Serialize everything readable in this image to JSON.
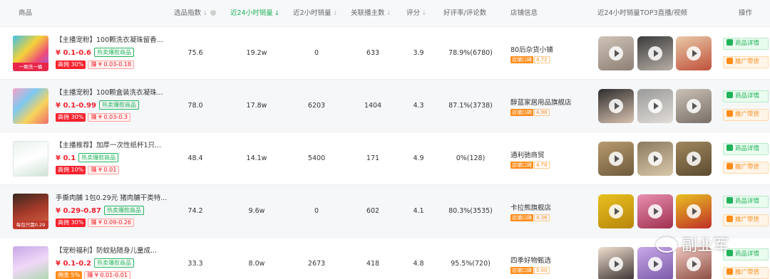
{
  "header": {
    "product": "商品",
    "index": "选品指数",
    "sales24": "近24小时销量",
    "sales2": "近2小时销量",
    "anchors": "关联播主数",
    "rating": "评分",
    "goodrate": "好评率/评论数",
    "shop": "店铺信息",
    "top3": "近24小时销量TOP3直播/视频",
    "action": "操作"
  },
  "icons": {
    "sort": "sort-arrow-icon",
    "info": "info-icon",
    "play": "play-icon",
    "detail": "shop-bag-icon",
    "promote": "cart-icon"
  },
  "colors": {
    "accent_green": "#21b35b",
    "price_red": "#f5222d",
    "shop_orange": "#ff8c1a"
  },
  "buttons": {
    "detail": "商品详情",
    "promote": "推广带货"
  },
  "tags": {
    "hot": "热卖爆款商品"
  },
  "rows": [
    {
      "thumb_text": "一颗洗一桶",
      "name": "【主播宠粉】100颗洗衣凝珠留香...",
      "price": "¥ 0.1-0.6",
      "commission": "高佣 30%",
      "earn": "赚 ¥ 0.03-0.18",
      "index": "75.6",
      "sales24": "19.2w",
      "sales2": "0",
      "anchors": "633",
      "rating": "3.9",
      "goodrate": "78.9%(6780)",
      "shop": "80后杂货小铺",
      "shop_tag": "店铺口碑",
      "shop_score": "4.72"
    },
    {
      "thumb_text": "",
      "name": "【主播宠粉】100颗盒装洗衣凝珠...",
      "price": "¥ 0.1-0.99",
      "commission": "高佣 30%",
      "earn": "赚 ¥ 0.03-0.3",
      "index": "78.0",
      "sales24": "17.8w",
      "sales2": "6203",
      "anchors": "1404",
      "rating": "4.3",
      "goodrate": "87.1%(3738)",
      "shop": "醇蓝家居用品旗舰店",
      "shop_tag": "店铺口碑",
      "shop_score": "4.98"
    },
    {
      "thumb_text": "",
      "name": "【主播推荐】加厚一次性纸杯1只...",
      "price": "¥ 0.1",
      "commission": "高佣 10%",
      "earn": "赚 ¥ 0.01",
      "index": "48.4",
      "sales24": "14.1w",
      "sales2": "5400",
      "anchors": "171",
      "rating": "4.9",
      "goodrate": "0%(128)",
      "shop": "通利驰商贸",
      "shop_tag": "店铺口碑",
      "shop_score": "4.78"
    },
    {
      "thumb_text": "每包只需0.29",
      "name": "手撕肉脯 1包0.29元 猪肉脯干类特...",
      "price": "¥ 0.29-0.87",
      "commission": "高佣 30%",
      "earn": "赚 ¥ 0.09-0.26",
      "index": "74.2",
      "sales24": "9.6w",
      "sales2": "0",
      "anchors": "602",
      "rating": "4.1",
      "goodrate": "80.3%(3535)",
      "shop": "卡拉熊旗舰店",
      "shop_tag": "店铺口碑",
      "shop_score": "4.36"
    },
    {
      "thumb_text": "",
      "name": "【宠粉福利】防蚊贴随身儿童成...",
      "price": "¥ 0.1-0.2",
      "commission": "佣金 5%",
      "earn": "赚 ¥ 0.01-0.01",
      "index": "33.3",
      "sales24": "8.0w",
      "sales2": "2673",
      "anchors": "418",
      "rating": "4.8",
      "goodrate": "95.5%(720)",
      "shop": "四季好物甄选",
      "shop_tag": "店铺口碑",
      "shop_score": "5.00"
    }
  ],
  "watermark": "副业军"
}
